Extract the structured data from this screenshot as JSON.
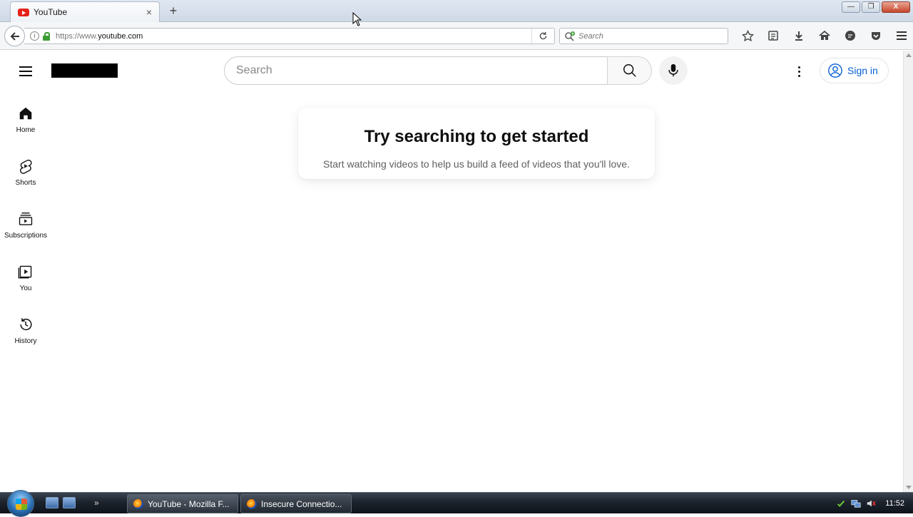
{
  "browser": {
    "tab": {
      "title": "YouTube",
      "close": "×"
    },
    "new_tab": "+",
    "url": {
      "prefix": "https://www.",
      "host": "youtube.com"
    },
    "search_placeholder": "Search",
    "window_controls": {
      "minimize": "—",
      "maximize": "❐",
      "close": "X"
    }
  },
  "youtube": {
    "search_placeholder": "Search",
    "sign_in": "Sign in",
    "sidebar": [
      {
        "label": "Home",
        "icon": "home-icon"
      },
      {
        "label": "Shorts",
        "icon": "shorts-icon"
      },
      {
        "label": "Subscriptions",
        "icon": "subscriptions-icon"
      },
      {
        "label": "You",
        "icon": "you-icon"
      },
      {
        "label": "History",
        "icon": "history-icon"
      }
    ],
    "empty_state": {
      "title": "Try searching to get started",
      "subtitle": "Start watching videos to help us build a feed of videos that you'll love."
    },
    "accent_color": "#065fd4"
  },
  "taskbar": {
    "more": "»",
    "tasks": [
      {
        "label": "YouTube - Mozilla F..."
      },
      {
        "label": "Insecure Connectio..."
      }
    ],
    "clock": "11:52"
  }
}
